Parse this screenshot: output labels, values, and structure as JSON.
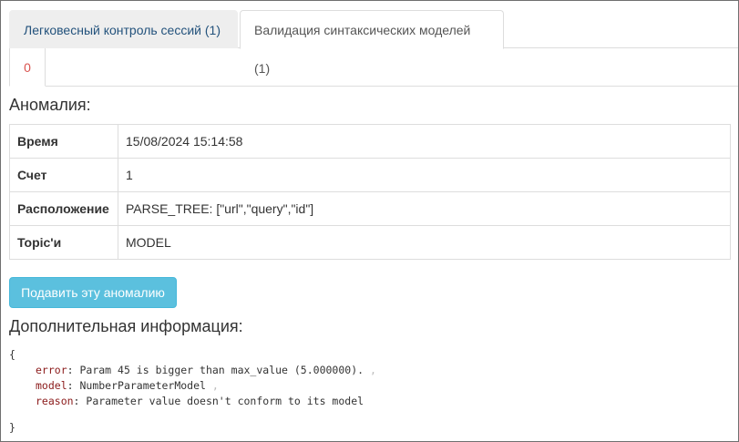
{
  "tabs": [
    {
      "label": "Легковесный контроль сессий (1)"
    },
    {
      "label": "Валидация синтаксических моделей (1)"
    }
  ],
  "subtab": {
    "label": "0"
  },
  "anomaly": {
    "heading": "Аномалия:",
    "rows": [
      {
        "key": "Время",
        "value": "15/08/2024 15:14:58"
      },
      {
        "key": "Счет",
        "value": "1"
      },
      {
        "key": "Расположение",
        "value": "PARSE_TREE: [\"url\",\"query\",\"id\"]"
      },
      {
        "key": "Topic'и",
        "value": "MODEL"
      }
    ]
  },
  "button": {
    "label": "Подавить эту аномалию"
  },
  "info": {
    "heading": "Дополнительная информация:",
    "open_brace": "{",
    "close_brace": "}",
    "fields": [
      {
        "key": "error",
        "value": "Param 45 is bigger than max_value (5.000000).",
        "comma": ","
      },
      {
        "key": "model",
        "value": "NumberParameterModel",
        "comma": ","
      },
      {
        "key": "reason",
        "value": "Parameter value doesn't conform to its model",
        "comma": ""
      }
    ]
  },
  "colors": {
    "tab_link": "#23527c",
    "subtab_text": "#d9534f",
    "button_bg": "#5bc0de",
    "json_key": "#8b1a1a"
  }
}
